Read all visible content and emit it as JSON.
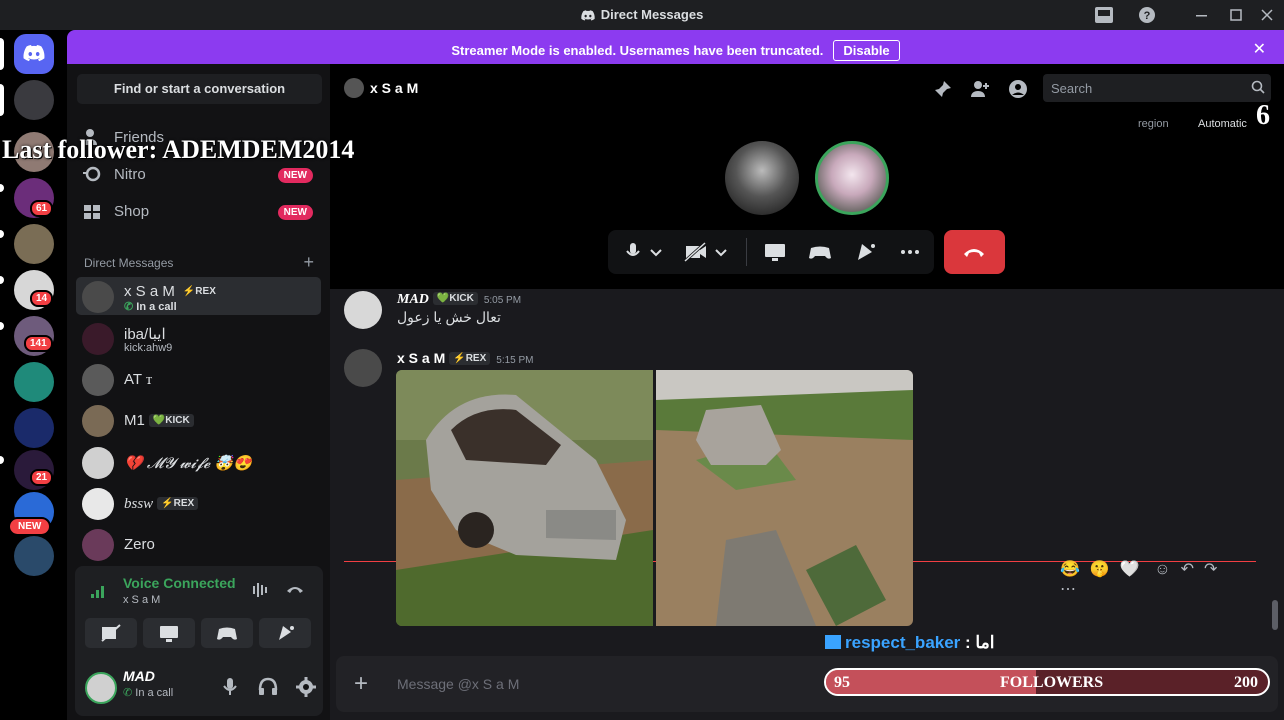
{
  "window": {
    "title": "Direct Messages"
  },
  "banner": {
    "text": "Streamer Mode is enabled. Usernames have been truncated.",
    "button": "Disable"
  },
  "guilds": [
    {
      "badge": ""
    },
    {
      "badge": ""
    },
    {
      "badge": "61"
    },
    {
      "badge": ""
    },
    {
      "badge": "14"
    },
    {
      "badge": "141"
    },
    {
      "badge": ""
    },
    {
      "badge": ""
    },
    {
      "badge": "21"
    },
    {
      "badge": "NEW"
    }
  ],
  "sidebar": {
    "find": "Find or start a conversation",
    "nav": [
      {
        "label": "Friends",
        "icon": "friends-icon"
      },
      {
        "label": "Nitro",
        "icon": "nitro-icon",
        "tag": "NEW"
      },
      {
        "label": "Shop",
        "icon": "shop-icon",
        "tag": "NEW"
      }
    ],
    "dm_header": "Direct Messages",
    "dms": [
      {
        "name": "x S a M",
        "tag": "⚡REX",
        "sub": "In a call"
      },
      {
        "name": "iba/ايبا",
        "sub": "kick:ahw9"
      },
      {
        "name": "AT ꭲ"
      },
      {
        "name": "M1",
        "tag": "💚KICK"
      },
      {
        "name": "💔 𝓜𝓨 𝔀𝓲𝓯𝓮 🤯😍"
      },
      {
        "name": "bssw",
        "tag": "⚡REX"
      },
      {
        "name": "Zero"
      }
    ]
  },
  "voice": {
    "status": "Voice Connected",
    "channel": "x S a M"
  },
  "user": {
    "name": "MAD",
    "status": "In a call"
  },
  "call": {
    "name": "x S a M",
    "search_placeholder": "Search",
    "region_label": "region",
    "region_value": "Automatic"
  },
  "messages": [
    {
      "author": "MAD",
      "tag": "💚KICK",
      "time": "5:05 PM",
      "text": "تعال خش يا زعول"
    },
    {
      "author": "x S a M",
      "tag": "⚡REX",
      "time": "5:15 PM",
      "text": ""
    }
  ],
  "reactions": [
    "😂",
    "🤫",
    "🤍"
  ],
  "composer": {
    "placeholder": "Message @x S a M"
  },
  "overlay": {
    "last_follower": "Last follower: ADEMDEM2014",
    "chat_user": "respect_baker",
    "chat_sep": " : ",
    "chat_text": "اما",
    "counter": "6",
    "followers_label": "FOLLOWERS",
    "followers_current": "95",
    "followers_goal": "200",
    "followers_progress": 0.475
  },
  "colors": {
    "accent": "#8c3bf0",
    "voice_green": "#3ba55c",
    "hangup": "#da373c",
    "badge": "#f23f43"
  }
}
